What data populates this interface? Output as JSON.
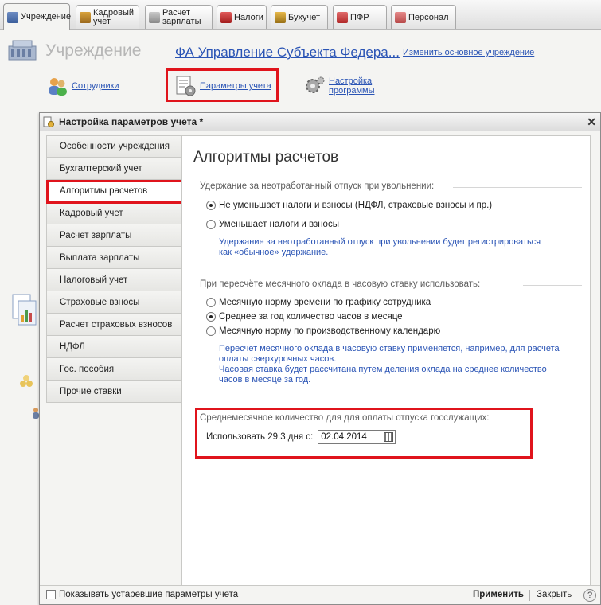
{
  "tabs": [
    {
      "label": "Учреждение",
      "icon": "building-icon",
      "active": true
    },
    {
      "label": "Кадровый\nучет",
      "icon": "hr-icon",
      "active": false
    },
    {
      "label": "Расчет\nзарплаты",
      "icon": "payroll-icon",
      "active": false
    },
    {
      "label": "Налоги",
      "icon": "tax-icon",
      "active": false
    },
    {
      "label": "Бухучет",
      "icon": "accounting-icon",
      "active": false
    },
    {
      "label": "ПФР",
      "icon": "pfr-icon",
      "active": false
    },
    {
      "label": "Персонал",
      "icon": "personnel-icon",
      "active": false
    }
  ],
  "header": {
    "title": "Учреждение",
    "org_name": "ФА Управление Субъекта Федера...",
    "change_link": "Изменить основное учреждение"
  },
  "quick_links": {
    "employees": "Сотрудники",
    "params": "Параметры учета",
    "settings": "Настройка\nпрограммы"
  },
  "modal": {
    "title": "Настройка параметров учета *",
    "nav": [
      "Особенности учреждения",
      "Бухгалтерский учет",
      "Алгоритмы расчетов",
      "Кадровый учет",
      "Расчет зарплаты",
      "Выплата зарплаты",
      "Налоговый учет",
      "Страховые взносы",
      "Расчет страховых взносов",
      "НДФЛ",
      "Гос. пособия",
      "Прочие ставки"
    ],
    "active_nav_index": 2,
    "section_title": "Алгоритмы расчетов",
    "group1": {
      "label": "Удержание за неотработанный отпуск при увольнении:",
      "options": [
        "Не уменьшает налоги и взносы (НДФЛ, страховые взносы и пр.)",
        "Уменьшает налоги и взносы"
      ],
      "selected": 0,
      "hint": "Удержание за неотработанный отпуск при увольнении будет регистрироваться\nкак «обычное» удержание."
    },
    "group2": {
      "label": "При пересчёте месячного оклада в часовую ставку использовать:",
      "options": [
        "Месячную норму времени по графику сотрудника",
        "Среднее за год количество часов в месяце",
        "Месячную норму по производственному календарю"
      ],
      "selected": 1,
      "hint": "Пересчет месячного оклада в часовую ставку применяется, например, для расчета\nоплаты сверхурочных часов.\nЧасовая ставка будет рассчитана путем деления оклада на среднее количество\nчасов в месяце за год."
    },
    "group3": {
      "label": "Среднемесячное количество для для оплаты отпуска госслужащих:",
      "use_label": "Использовать 29.3 дня с:",
      "date_value": "02.04.2014"
    },
    "footer": {
      "checkbox_label": "Показывать устаревшие параметры учета",
      "apply": "Применить",
      "close": "Закрыть",
      "help": "?"
    }
  },
  "colors": {
    "accent_link": "#2a54b5",
    "highlight": "#e0141c"
  }
}
